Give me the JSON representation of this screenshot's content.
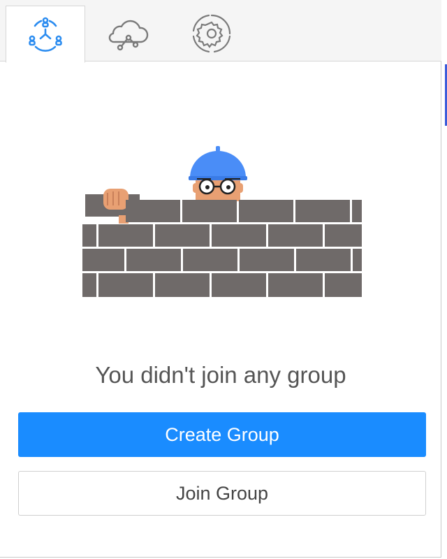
{
  "tabs": [
    {
      "name": "groups",
      "icon": "groups-icon",
      "active": true
    },
    {
      "name": "cloud",
      "icon": "cloud-share-icon",
      "active": false
    },
    {
      "name": "settings",
      "icon": "settings-gear-icon",
      "active": false
    }
  ],
  "empty_state": {
    "illustration": "worker-behind-brick-wall",
    "message": "You didn't join any group"
  },
  "actions": {
    "create_label": "Create Group",
    "join_label": "Join Group"
  },
  "colors": {
    "accent": "#1a8cff",
    "icon_active": "#2b8cf0",
    "icon_inactive": "#7a7a7a",
    "brick": "#6f6a69",
    "helmet": "#4a8df7"
  }
}
